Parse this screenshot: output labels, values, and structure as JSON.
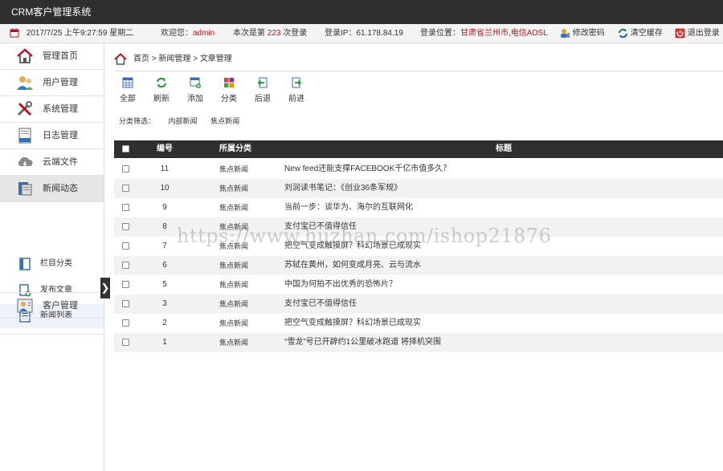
{
  "app": {
    "title": "CRM客户管理系统"
  },
  "infobar": {
    "datetime": "2017/7/25 上午9:27:59 星期二",
    "welcome_prefix": "欢迎您：",
    "username": "admin",
    "login_count_prefix": "本次是第",
    "login_count": "223",
    "login_count_suffix": "次登录",
    "ip_label": "登录IP：",
    "ip": "61.178.84.19",
    "location_label": "登录位置：",
    "location": "甘肃省兰州市,电信ADSL",
    "change_password": "修改密码",
    "clear_cache": "清空缓存",
    "logout": "退出登录"
  },
  "sidebar": {
    "items": [
      {
        "label": "管理首页",
        "icon": "home-icon"
      },
      {
        "label": "用户管理",
        "icon": "users-icon"
      },
      {
        "label": "系统管理",
        "icon": "tools-icon"
      },
      {
        "label": "日志管理",
        "icon": "log-icon"
      },
      {
        "label": "云端文件",
        "icon": "cloud-icon"
      },
      {
        "label": "新闻动态",
        "icon": "news-icon",
        "active": true
      },
      {
        "label": "客户管理",
        "icon": "customer-icon"
      }
    ],
    "subitems": [
      {
        "label": "栏目分类",
        "icon": "category-icon"
      },
      {
        "label": "发布文章",
        "icon": "publish-icon"
      },
      {
        "label": "新闻列表",
        "icon": "list-icon",
        "active": true
      }
    ],
    "collapse_glyph": "❯"
  },
  "breadcrumb": {
    "home": "首页",
    "sep": ">",
    "level1": "新闻管理",
    "level2": "文章管理"
  },
  "toolbar": {
    "all": "全部",
    "refresh": "刷新",
    "add": "添加",
    "category": "分类",
    "back": "后退",
    "forward": "前进"
  },
  "filter": {
    "label": "分类筛选：",
    "options": [
      "内部新闻",
      "焦点新闻"
    ]
  },
  "table": {
    "headers": {
      "id": "编号",
      "category": "所属分类",
      "title": "标题"
    },
    "rows": [
      {
        "id": "11",
        "category": "焦点新闻",
        "title": "New feed还能支撑FACEBOOK千亿市值多久？"
      },
      {
        "id": "10",
        "category": "焦点新闻",
        "title": "刘润读书笔记：《创业36条军规》"
      },
      {
        "id": "9",
        "category": "焦点新闻",
        "title": "当前一步：谈华为、海尔的互联网化"
      },
      {
        "id": "8",
        "category": "焦点新闻",
        "title": "支付宝已不值得信任"
      },
      {
        "id": "7",
        "category": "焦点新闻",
        "title": "把空气变成触摸屏？科幻场景已成现实"
      },
      {
        "id": "6",
        "category": "焦点新闻",
        "title": "苏轼在黄州，如何变成月亮、云与流水"
      },
      {
        "id": "5",
        "category": "焦点新闻",
        "title": "中国为何拍不出优秀的恐怖片？"
      },
      {
        "id": "3",
        "category": "焦点新闻",
        "title": "支付宝已不值得信任"
      },
      {
        "id": "2",
        "category": "焦点新闻",
        "title": "把空气变成触摸屏？科幻场景已成现实"
      },
      {
        "id": "1",
        "category": "焦点新闻",
        "title": "“雪龙”号已开辟约1公里破冰跑道 将择机突围"
      }
    ]
  },
  "watermark": "https://www.huzhan.com/ishop21876",
  "colors": {
    "accent_red": "#c0101a",
    "header_dark": "#2f2f2f"
  }
}
